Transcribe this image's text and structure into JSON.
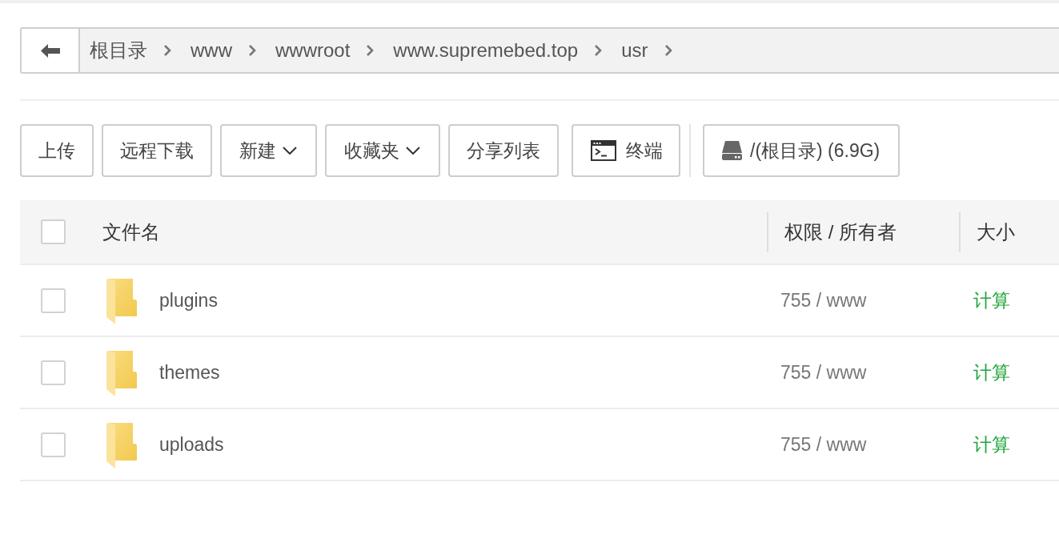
{
  "breadcrumb": {
    "items": [
      "根目录",
      "www",
      "wwwroot",
      "www.supremebed.top",
      "usr"
    ]
  },
  "toolbar": [
    {
      "label": "上传",
      "kind": "plain"
    },
    {
      "label": "远程下载",
      "kind": "plain"
    },
    {
      "label": "新建",
      "kind": "dropdown"
    },
    {
      "label": "收藏夹",
      "kind": "dropdown"
    },
    {
      "label": "分享列表",
      "kind": "plain"
    },
    {
      "label": "终端",
      "kind": "terminal"
    },
    {
      "label": "/(根目录) (6.9G)",
      "kind": "disk"
    }
  ],
  "table": {
    "select_all": {
      "checked": false
    },
    "columns": [
      "文件名",
      "权限 / 所有者",
      "大小"
    ],
    "rows": [
      {
        "kind": "folder",
        "name": "plugins",
        "permissions": "755 / www",
        "size": "计算",
        "checked": false
      },
      {
        "kind": "folder",
        "name": "themes",
        "permissions": "755 / www",
        "size": "计算",
        "checked": false
      },
      {
        "kind": "folder",
        "name": "uploads",
        "permissions": "755 / www",
        "size": "计算",
        "checked": false
      }
    ]
  }
}
